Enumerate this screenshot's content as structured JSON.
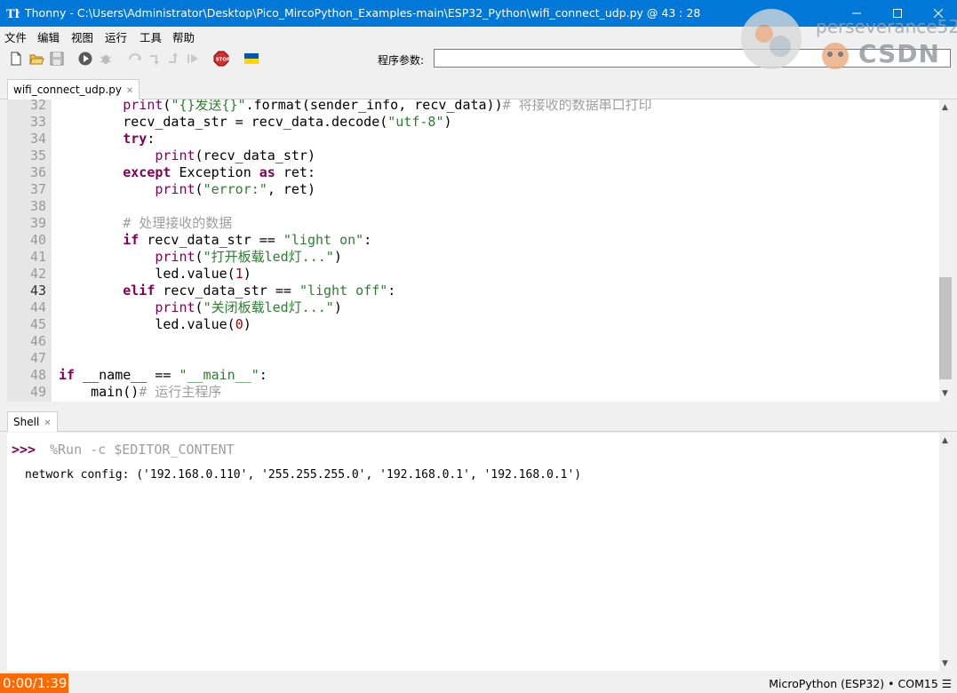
{
  "window": {
    "title": "Thonny  -  C:\\Users\\Administrator\\Desktop\\Pico_MircoPython_Examples-main\\ESP32_Python\\wifi_connect_udp.py  @  43 : 28",
    "minimize_icon": "minimize-icon",
    "maximize_icon": "maximize-icon",
    "close_icon": "close-icon"
  },
  "menu": {
    "items": [
      "文件",
      "编辑",
      "视图",
      "运行",
      "工具",
      "帮助"
    ]
  },
  "toolbar": {
    "icons": [
      "new-file-icon",
      "open-file-icon",
      "save-icon",
      "run-icon",
      "debug-icon",
      "step-over-icon",
      "step-into-icon",
      "step-out-icon",
      "resume-icon",
      "stop-icon",
      "ukraine-flag-icon"
    ],
    "args_label": "程序参数:",
    "args_value": ""
  },
  "watermark": {
    "username": "perseverance52",
    "site": "CSDN"
  },
  "editor": {
    "tab_label": "wifi_connect_udp.py",
    "current_line": 43,
    "line_numbers": [
      "32",
      "33",
      "34",
      "35",
      "36",
      "37",
      "38",
      "39",
      "40",
      "41",
      "42",
      "43",
      "44",
      "45",
      "46",
      "47",
      "48",
      "49"
    ],
    "lines": [
      "        print(\"{}发送{}\".format(sender_info, recv_data))# 将接收的数据串口打印",
      "        recv_data_str = recv_data.decode(\"utf-8\")",
      "        try:",
      "            print(recv_data_str)",
      "        except Exception as ret:",
      "            print(\"error:\", ret)",
      "",
      "        # 处理接收的数据",
      "        if recv_data_str == \"light on\":",
      "            print(\"打开板载led灯...\")",
      "            led.value(1)",
      "        elif recv_data_str == \"light off\":",
      "            print(\"关闭板载led灯...\")",
      "            led.value(0)",
      "",
      "",
      "if __name__ == \"__main__\":",
      "    main()# 运行主程序"
    ]
  },
  "shell": {
    "tab_label": "Shell",
    "prompt": ">>>",
    "command": "%Run -c $EDITOR_CONTENT",
    "output": "network config: ('192.168.0.110', '255.255.255.0', '192.168.0.1', '192.168.0.1')"
  },
  "statusbar": {
    "timer": "0:00/1:39",
    "interpreter": "MicroPython (ESP32)",
    "separator": "•",
    "port": "COM15",
    "menu_icon": "hamburger-menu-icon"
  },
  "colors": {
    "titlebar": "#0078d7",
    "keyword": "#7f0055",
    "string": "#2e7d32",
    "number": "#b00000",
    "comment": "#9e9e9e",
    "timer_bg": "#ff6a00"
  }
}
